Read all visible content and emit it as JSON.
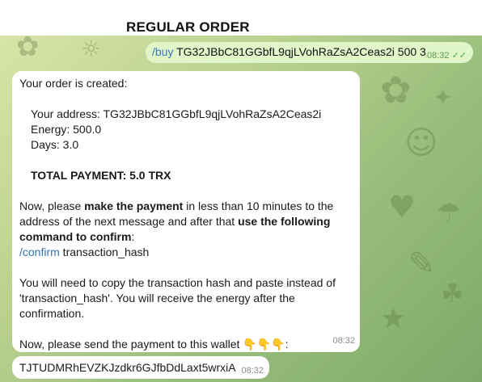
{
  "page_title": "REGULAR ORDER",
  "outgoing": {
    "command": "/buy",
    "args": "TG32JBbC81GGbfL9qjLVohRaZsA2Ceas2i 500 3",
    "time": "08:32",
    "status_icon": "double-check-icon"
  },
  "order_message": {
    "header": "Your order is created:",
    "address_line": "Your address: TG32JBbC81GGbfL9qjLVohRaZsA2Ceas2i",
    "energy_line": "Energy: 500.0",
    "days_line": "Days: 3.0",
    "total_line": "TOTAL PAYMENT: 5.0 TRX",
    "instr_part1": "Now, please ",
    "instr_bold1": "make the payment",
    "instr_part2": " in less than 10 minutes to the",
    "instr_line2_part1": "address of the next message and after that ",
    "instr_line2_bold": "use the following",
    "instr_line3_bold": "command to confirm",
    "instr_line3_end": ":",
    "confirm_command": "/confirm",
    "confirm_arg": " transaction_hash",
    "note_line1": "You will need to copy the transaction hash and paste instead of",
    "note_line2": "'transaction_hash'. You will receive the energy after the",
    "note_line3": "confirmation.",
    "send_line": "Now, please send the payment to this wallet ",
    "send_emojis": "👇👇👇",
    "send_colon": ":",
    "time": "08:32"
  },
  "wallet_message": {
    "address": "TJTUDMRhEVZKJzdkr6GJfbDdLaxt5wrxiA",
    "time": "08:32"
  }
}
